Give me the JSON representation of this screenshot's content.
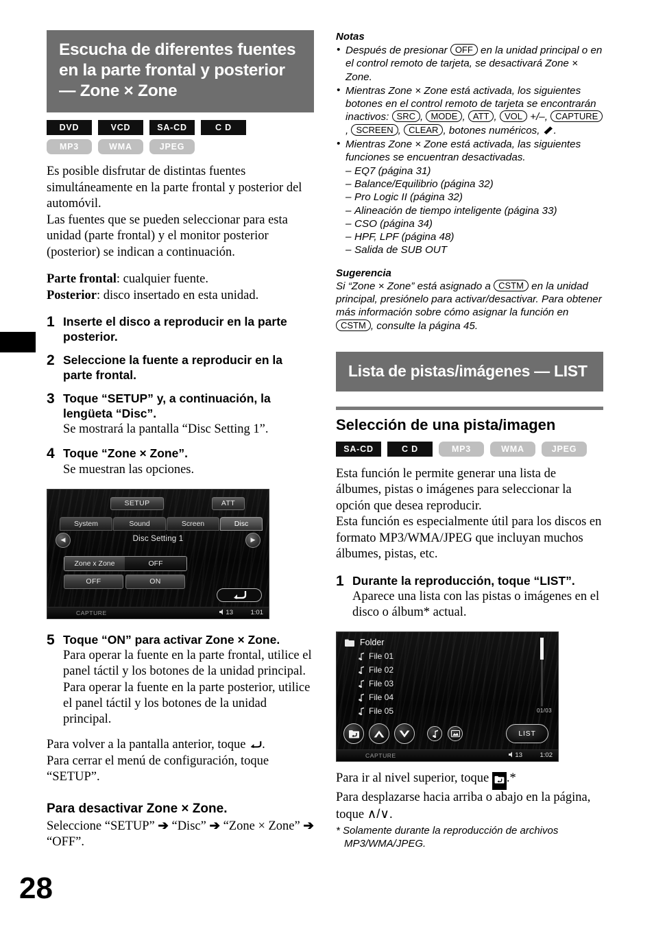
{
  "page": {
    "number": "28"
  },
  "left": {
    "chapter_title": "Escucha de diferentes fuentes en la parte frontal y posterior — Zone × Zone",
    "badges_dark": [
      "DVD",
      "VCD",
      "SA-CD",
      "C D"
    ],
    "badges_light": [
      "MP3",
      "WMA",
      "JPEG"
    ],
    "intro_p1": "Es posible disfrutar de distintas fuentes simultáneamente en la parte frontal y posterior del automóvil.",
    "intro_p2": "Las fuentes que se pueden seleccionar para esta unidad (parte frontal) y el monitor posterior (posterior) se indican a continuación.",
    "def_front_label": "Parte frontal",
    "def_front_value": ": cualquier fuente.",
    "def_rear_label": "Posterior",
    "def_rear_value": ": disco insertado en esta unidad.",
    "steps": [
      {
        "num": "1",
        "title": "Inserte el disco a reproducir en la parte posterior.",
        "sub": ""
      },
      {
        "num": "2",
        "title": "Seleccione la fuente a reproducir en la parte frontal.",
        "sub": ""
      },
      {
        "num": "3",
        "title": "Toque “SETUP” y, a continuación, la lengüeta “Disc”.",
        "sub": "Se mostrará la pantalla “Disc Setting 1”."
      },
      {
        "num": "4",
        "title": "Toque “Zone × Zone”.",
        "sub": "Se muestran las opciones."
      }
    ],
    "step5": {
      "num": "5",
      "title": "Toque “ON” para activar Zone × Zone.",
      "sub1": "Para operar la fuente en la parte frontal, utilice el panel táctil y los botones de la unidad principal.",
      "sub2": "Para operar la fuente en la parte posterior, utilice el panel táctil y los botones de la unidad principal."
    },
    "after_steps_1a": "Para volver a la pantalla anterior, toque ",
    "after_steps_1b": ".",
    "after_steps_2": "Para cerrar el menú de configuración, toque “SETUP”.",
    "deactivate_heading": "Para desactivar Zone × Zone.",
    "deactivate_body_1": "Seleccione “SETUP”",
    "deactivate_body_2": "“Disc”",
    "deactivate_body_3": "“Zone × Zone”",
    "deactivate_body_4": "“OFF”.",
    "arrow": "➔"
  },
  "screen1": {
    "setup_button": "SETUP",
    "att_button": "ATT",
    "tabs": [
      "System",
      "Sound",
      "Screen",
      "Disc"
    ],
    "active_tab": "Disc",
    "title": "Disc Setting 1",
    "option_label": "Zone x Zone",
    "option_value": "OFF",
    "choice_off": "OFF",
    "choice_on": "ON",
    "prev_arrow": "◀",
    "next_arrow": "▶",
    "back_icon": "back-arrow-icon",
    "status_capture": "CAPTURE",
    "status_volume": "13",
    "status_clock": "1:01"
  },
  "right": {
    "notes_title": "Notas",
    "note1_a": "Después de presionar ",
    "note1_key": "OFF",
    "note1_b": " en la unidad principal o en el control remoto de tarjeta, se desactivará Zone × Zone.",
    "note2_a": "Mientras Zone × Zone está activada, los siguientes botones en el control remoto de tarjeta se encontrarán inactivos: ",
    "note2_keys": [
      "SRC",
      "MODE",
      "ATT",
      "VOL",
      "CAPTURE",
      "SCREEN",
      "CLEAR"
    ],
    "note2_volsuffix": " +/–, ",
    "note2_b": "botones numéricos, ",
    "note3": "Mientras Zone × Zone está activada, las siguientes funciones se encuentran desactivadas.",
    "note3_items": [
      "EQ7 (página 31)",
      "Balance/Equilibrio (página 32)",
      "Pro Logic II (página 32)",
      "Alineación de tiempo inteligente (página 33)",
      "CSO (página 34)",
      "HPF, LPF (página 48)",
      "Salida de SUB OUT"
    ],
    "tip_title": "Sugerencia",
    "tip_a": "Si “Zone × Zone” está asignado a ",
    "tip_key1": "CSTM",
    "tip_b": " en la unidad principal, presiónelo para activar/desactivar. Para obtener más información sobre cómo asignar la función en ",
    "tip_key2": "CSTM",
    "tip_c": ", consulte la página 45.",
    "chapter_title": "Lista de pistas/imágenes — LIST",
    "sub_head": "Selección de una pista/imagen",
    "badges_dark": [
      "SA-CD",
      "C D"
    ],
    "badges_light": [
      "MP3",
      "WMA",
      "JPEG"
    ],
    "body_p1": "Esta función le permite generar una lista de álbumes, pistas o imágenes para seleccionar la opción que desea reproducir.",
    "body_p2": "Esta función es especialmente útil para los discos en formato MP3/WMA/JPEG que incluyan muchos álbumes, pistas, etc.",
    "step1": {
      "num": "1",
      "title": "Durante la reproducción, toque “LIST”.",
      "sub": "Aparece una lista con las pistas o imágenes en el disco o álbum* actual."
    },
    "after_1a": "Para ir al nivel superior, toque ",
    "after_1b": ".*",
    "after_2a": "Para desplazarse hacia arriba o abajo en la página, toque ",
    "after_2b": "∧/∨",
    "after_2c": ".",
    "footnote": "* Solamente durante la reproducción de archivos MP3/WMA/JPEG."
  },
  "screen2": {
    "folder_label": "Folder",
    "files": [
      "File 01",
      "File 02",
      "File 03",
      "File 04",
      "File 05"
    ],
    "page_count": "01/03",
    "list_button": "LIST",
    "back_icon": "folder-back-icon",
    "up_icon": "chevron-up-icon",
    "down_icon": "chevron-down-icon",
    "music_icon": "music-note-icon",
    "image_icon": "image-icon",
    "status_capture": "CAPTURE",
    "status_volume": "13",
    "status_clock": "1:02"
  },
  "colors": {
    "header_gray": "#6e6e6e",
    "badge_dark": "#101010",
    "badge_light": "#bfbfbf",
    "rule_gray": "#7a7a7a"
  }
}
